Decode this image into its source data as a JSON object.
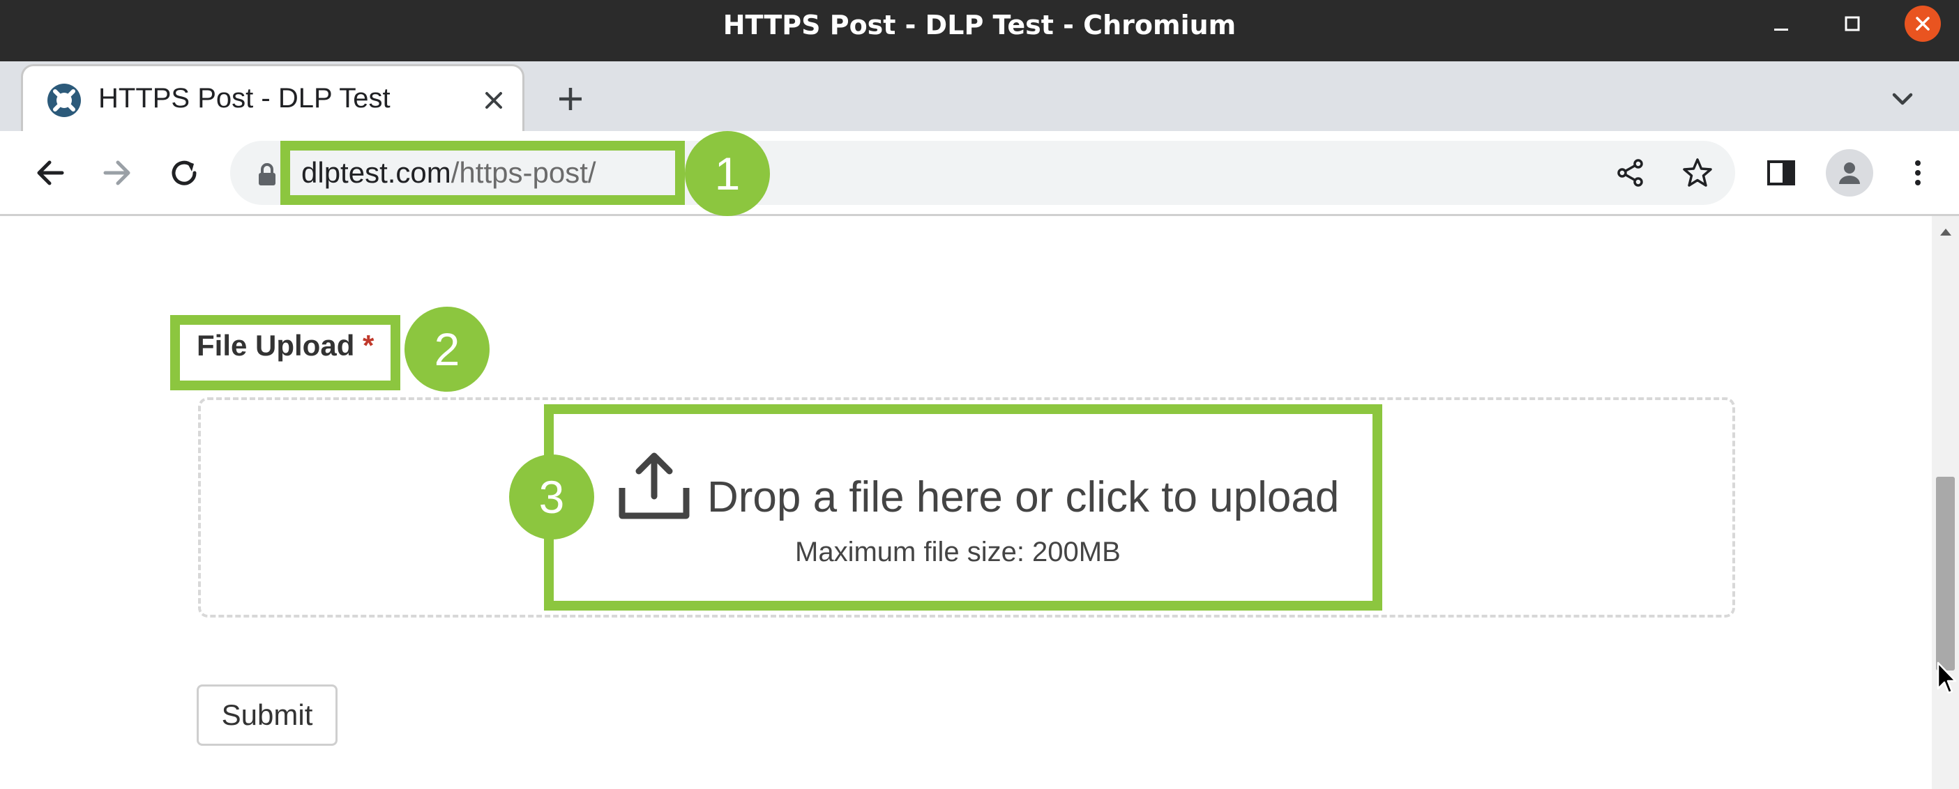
{
  "window": {
    "title": "HTTPS Post - DLP Test - Chromium",
    "controls": [
      "minimize-icon",
      "maximize-icon",
      "close-icon"
    ],
    "close_color": "#e95420"
  },
  "tab": {
    "title": "HTTPS Post - DLP Test",
    "favicon": "dlptest-logo-icon"
  },
  "address_bar": {
    "host": "dlptest.com",
    "path": "/https-post/"
  },
  "form": {
    "field_label": "File Upload",
    "required_mark": "*",
    "dropzone_text": "Drop a file here or click to upload",
    "dropzone_subtext": "Maximum file size: 200MB",
    "submit_label": "Submit"
  },
  "annotations": {
    "accent": "#8cc63f",
    "steps": [
      "1",
      "2",
      "3"
    ]
  }
}
